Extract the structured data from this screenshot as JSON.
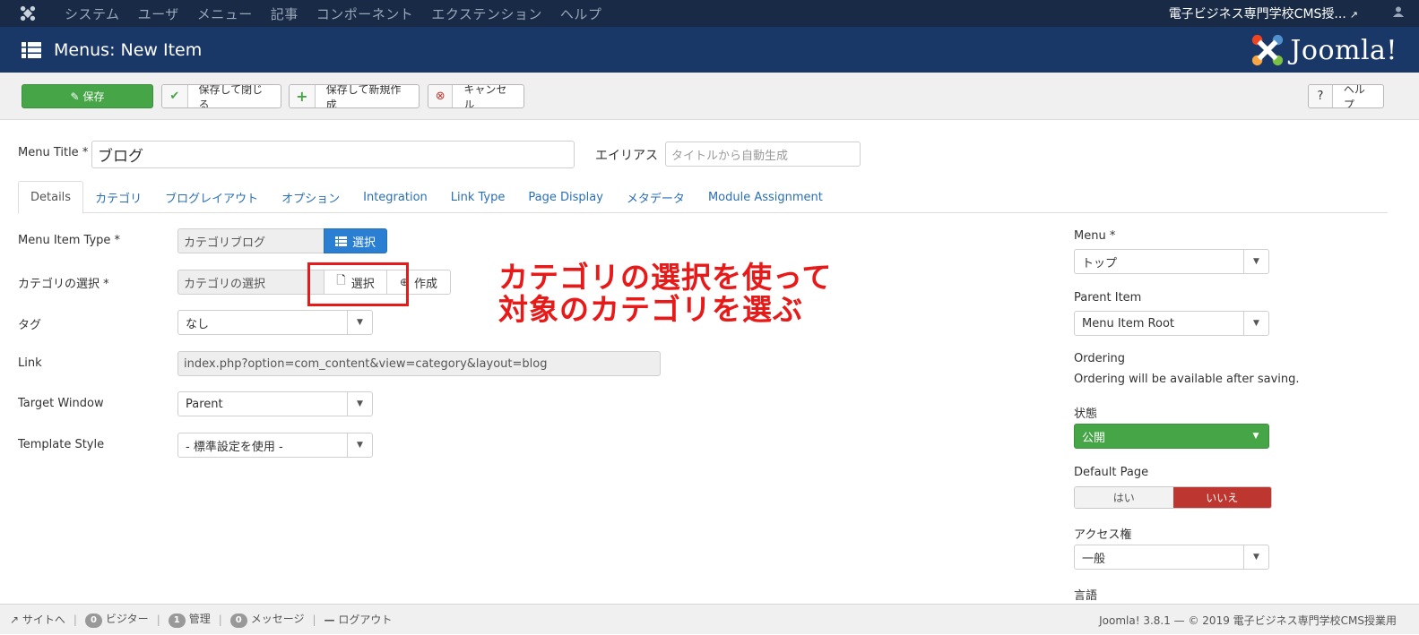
{
  "topnav": {
    "items": [
      "システム",
      "ユーザ",
      "メニュー",
      "記事",
      "コンポーネント",
      "エクステンション",
      "ヘルプ"
    ],
    "site_name": "電子ビジネス専門学校CMS授..."
  },
  "header": {
    "title": "Menus: New Item",
    "brand": "Joomla!"
  },
  "toolbar": {
    "save": "保存",
    "save_close": "保存して閉じる",
    "save_new": "保存して新規作成",
    "cancel": "キャンセル",
    "help": "ヘルプ"
  },
  "form": {
    "menu_title_label": "Menu Title *",
    "menu_title_value": "ブログ",
    "alias_label": "エイリアス",
    "alias_placeholder": "タイトルから自動生成"
  },
  "tabs": [
    "Details",
    "カテゴリ",
    "ブログレイアウト",
    "オプション",
    "Integration",
    "Link Type",
    "Page Display",
    "メタデータ",
    "Module Assignment"
  ],
  "details": {
    "menu_item_type_label": "Menu Item Type *",
    "menu_item_type_value": "カテゴリブログ",
    "select_label": "選択",
    "category_label": "カテゴリの選択 *",
    "category_value": "カテゴリの選択",
    "category_select": "選択",
    "category_create": "作成",
    "tag_label": "タグ",
    "tag_value": "なし",
    "link_label": "Link",
    "link_value": "index.php?option=com_content&view=category&layout=blog",
    "target_label": "Target Window",
    "target_value": "Parent",
    "template_label": "Template Style",
    "template_value": "- 標準設定を使用 -"
  },
  "annotation": {
    "line1": "カテゴリの選択を使って",
    "line2": "対象のカテゴリを選ぶ"
  },
  "sidebar": {
    "menu_label": "Menu *",
    "menu_value": "トップ",
    "parent_label": "Parent Item",
    "parent_value": "Menu Item Root",
    "ordering_label": "Ordering",
    "ordering_text": "Ordering will be available after saving.",
    "status_label": "状態",
    "status_value": "公開",
    "default_label": "Default Page",
    "default_yes": "はい",
    "default_no": "いいえ",
    "access_label": "アクセス権",
    "access_value": "一般",
    "language_label": "言語"
  },
  "footer": {
    "site": "サイトへ",
    "visitors_count": "0",
    "visitors": "ビジター",
    "admin_count": "1",
    "admin": "管理",
    "messages_count": "0",
    "messages": "メッセージ",
    "logout": "ログアウト",
    "version": "Joomla! 3.8.1 — © 2019 電子ビジネス専門学校CMS授業用"
  },
  "colors": {
    "topnav_bg": "#182a45",
    "header_bg": "#1a3867",
    "save_green": "#46a546",
    "select_blue": "#2a7fd2",
    "no_red": "#bd362f",
    "annotation_red": "#e81919"
  }
}
